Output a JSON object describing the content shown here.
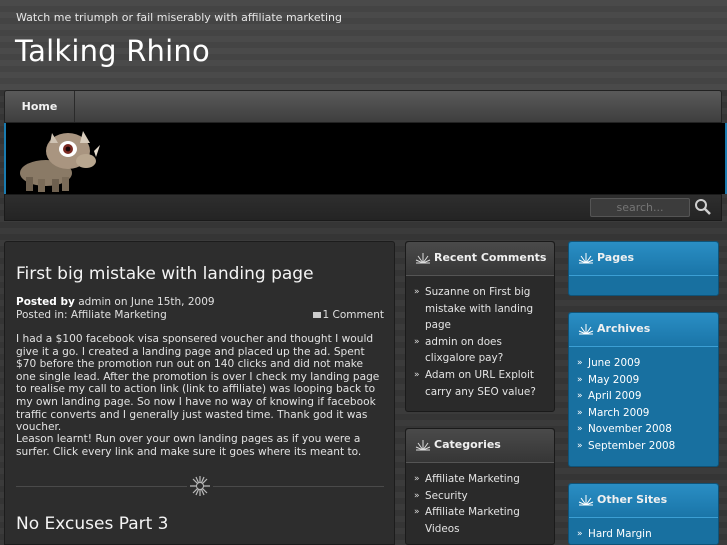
{
  "header": {
    "tagline": "Watch me triumph or fail miserably with affiliate marketing",
    "site_title": "Talking Rhino"
  },
  "nav": {
    "home": "Home"
  },
  "search": {
    "placeholder": "search..."
  },
  "post": {
    "title": "First big mistake with landing page",
    "posted_by_label": "Posted by",
    "posted_by_value": "admin on June 15th, 2009",
    "posted_in_label": "Posted in:",
    "posted_in_value": "Affiliate Marketing",
    "comments": "1 Comment",
    "para1": "I had a $100 facebook visa sponsered voucher and thought I would give it a go. I created a landing page and placed up the ad. Spent $70 before the promotion run out on 140 clicks and did not make one single lead. After the promotion is over I check my landing page to realise my call to action link (link to affiliate) was looping back to my own landing page. So now I have no way of knowing if facebook traffic converts and I generally just wasted time. Thank god it was voucher.",
    "para2": "Leason learnt! Run over your own landing pages as if you were a surfer. Click every link and make sure it goes where its meant to."
  },
  "next_post": {
    "title": "No Excuses Part 3"
  },
  "sidebar_left": {
    "recent_comments": {
      "title": "Recent Comments",
      "items": [
        "Suzanne on First big mistake with landing page",
        "admin on does clixgalore pay?",
        "Adam on URL Exploit carry any SEO value?"
      ]
    },
    "categories": {
      "title": "Categories",
      "items": [
        "Affiliate Marketing",
        "Security",
        "Affiliate Marketing Videos"
      ]
    }
  },
  "sidebar_right": {
    "pages": {
      "title": "Pages"
    },
    "archives": {
      "title": "Archives",
      "items": [
        "June 2009",
        "May 2009",
        "April 2009",
        "March 2009",
        "November 2008",
        "September 2008"
      ]
    },
    "other_sites": {
      "title": "Other Sites",
      "items": [
        "Hard Margin"
      ]
    }
  },
  "colors": {
    "accent_blue": "#1870a0",
    "dark_bg": "#2d2d2d"
  }
}
